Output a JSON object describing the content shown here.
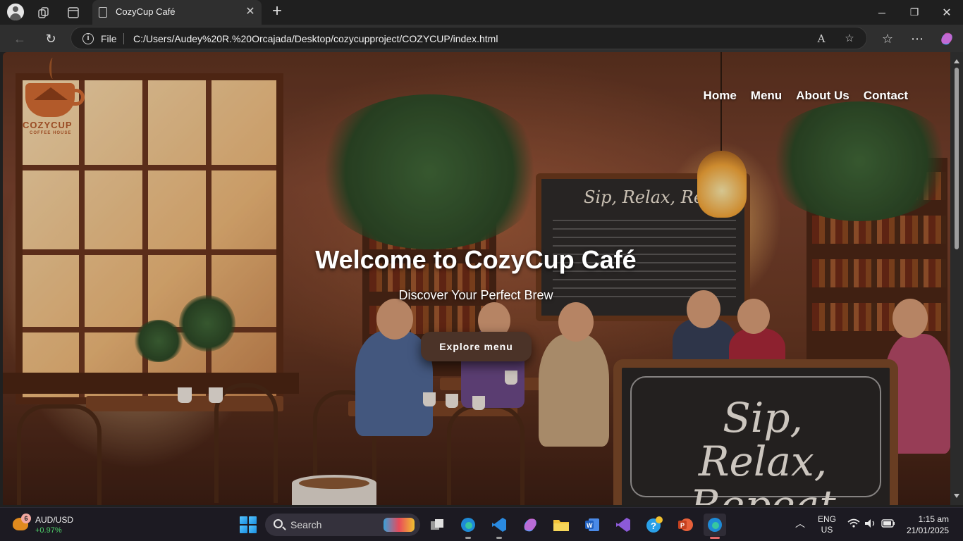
{
  "browser": {
    "tab_title": "CozyCup Café",
    "address_scheme": "File",
    "address_url": "C:/Users/Audey%20R.%20Orcajada/Desktop/cozycupproject/COZYCUP/index.html"
  },
  "site": {
    "logo_name": "COZYCUP",
    "logo_sub": "COFFEE HOUSE",
    "nav": [
      "Home",
      "Menu",
      "About Us",
      "Contact"
    ],
    "hero_title": "Welcome to CozyCup Café",
    "hero_subtitle": "Discover Your Perfect Brew",
    "hero_button": "Explore menu",
    "chalkboard_title": "Sip, Relax, Repeat",
    "sign_text": "Sip, Relax, Repeat"
  },
  "taskbar": {
    "widget_badge": "6",
    "widget_pair": "AUD/USD",
    "widget_change": "+0.97%",
    "search_label": "Search",
    "lang_top": "ENG",
    "lang_bottom": "US",
    "time": "1:15 am",
    "date": "21/01/2025"
  },
  "colors": {
    "browser_bg": "#1f1f1f",
    "toolbar_bg": "#2f2f2f",
    "button_bg": "#4b3328",
    "positive": "#4fd16b"
  }
}
